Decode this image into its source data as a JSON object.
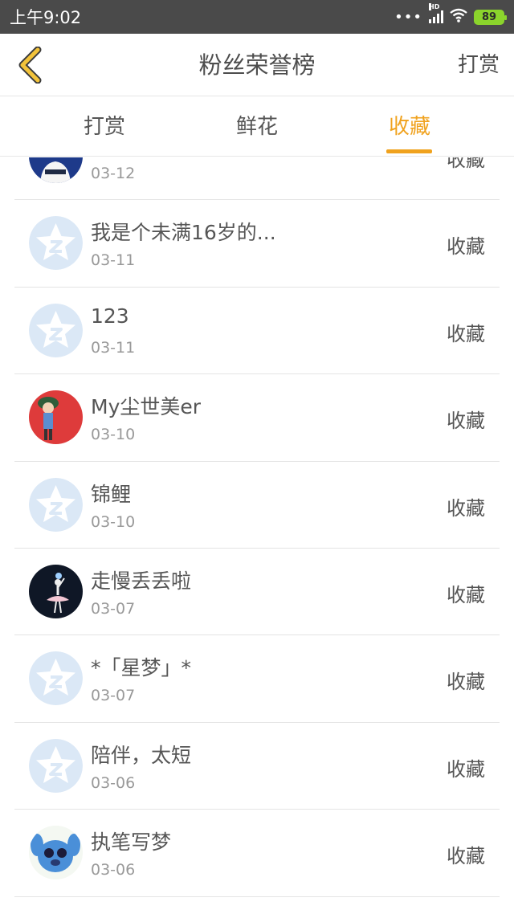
{
  "status": {
    "time": "上午9:02",
    "dots": "•••",
    "network": "HD",
    "battery": "89"
  },
  "nav": {
    "title": "粉丝荣誉榜",
    "action": "打赏"
  },
  "tabs": [
    {
      "label": "打赏",
      "active": false
    },
    {
      "label": "鲜花",
      "active": false
    },
    {
      "label": "收藏",
      "active": true
    }
  ],
  "colors": {
    "accent": "#f0a21e",
    "status_bg": "#4a4a4a",
    "default_avatar_bg": "#dbe8f6"
  },
  "rows": [
    {
      "name": "��",
      "date": "03-12",
      "action": "收藏",
      "avatar": "photo-person-icon"
    },
    {
      "name": "我是个未满16岁的...",
      "date": "03-11",
      "action": "收藏",
      "avatar": "default-avatar-icon"
    },
    {
      "name": "123",
      "date": "03-11",
      "action": "收藏",
      "avatar": "default-avatar-icon"
    },
    {
      "name": "My尘世美er",
      "date": "03-10",
      "action": "收藏",
      "avatar": "cartoon-boy-icon"
    },
    {
      "name": "锦鲤",
      "date": "03-10",
      "action": "收藏",
      "avatar": "default-avatar-icon"
    },
    {
      "name": "走慢丢丢啦",
      "date": "03-07",
      "action": "收藏",
      "avatar": "ballerina-icon"
    },
    {
      "name": "*「星梦」*",
      "date": "03-07",
      "action": "收藏",
      "avatar": "default-avatar-icon"
    },
    {
      "name": "陪伴，太短",
      "date": "03-06",
      "action": "收藏",
      "avatar": "default-avatar-icon"
    },
    {
      "name": "执笔写梦",
      "date": "03-06",
      "action": "收藏",
      "avatar": "stitch-icon"
    }
  ]
}
